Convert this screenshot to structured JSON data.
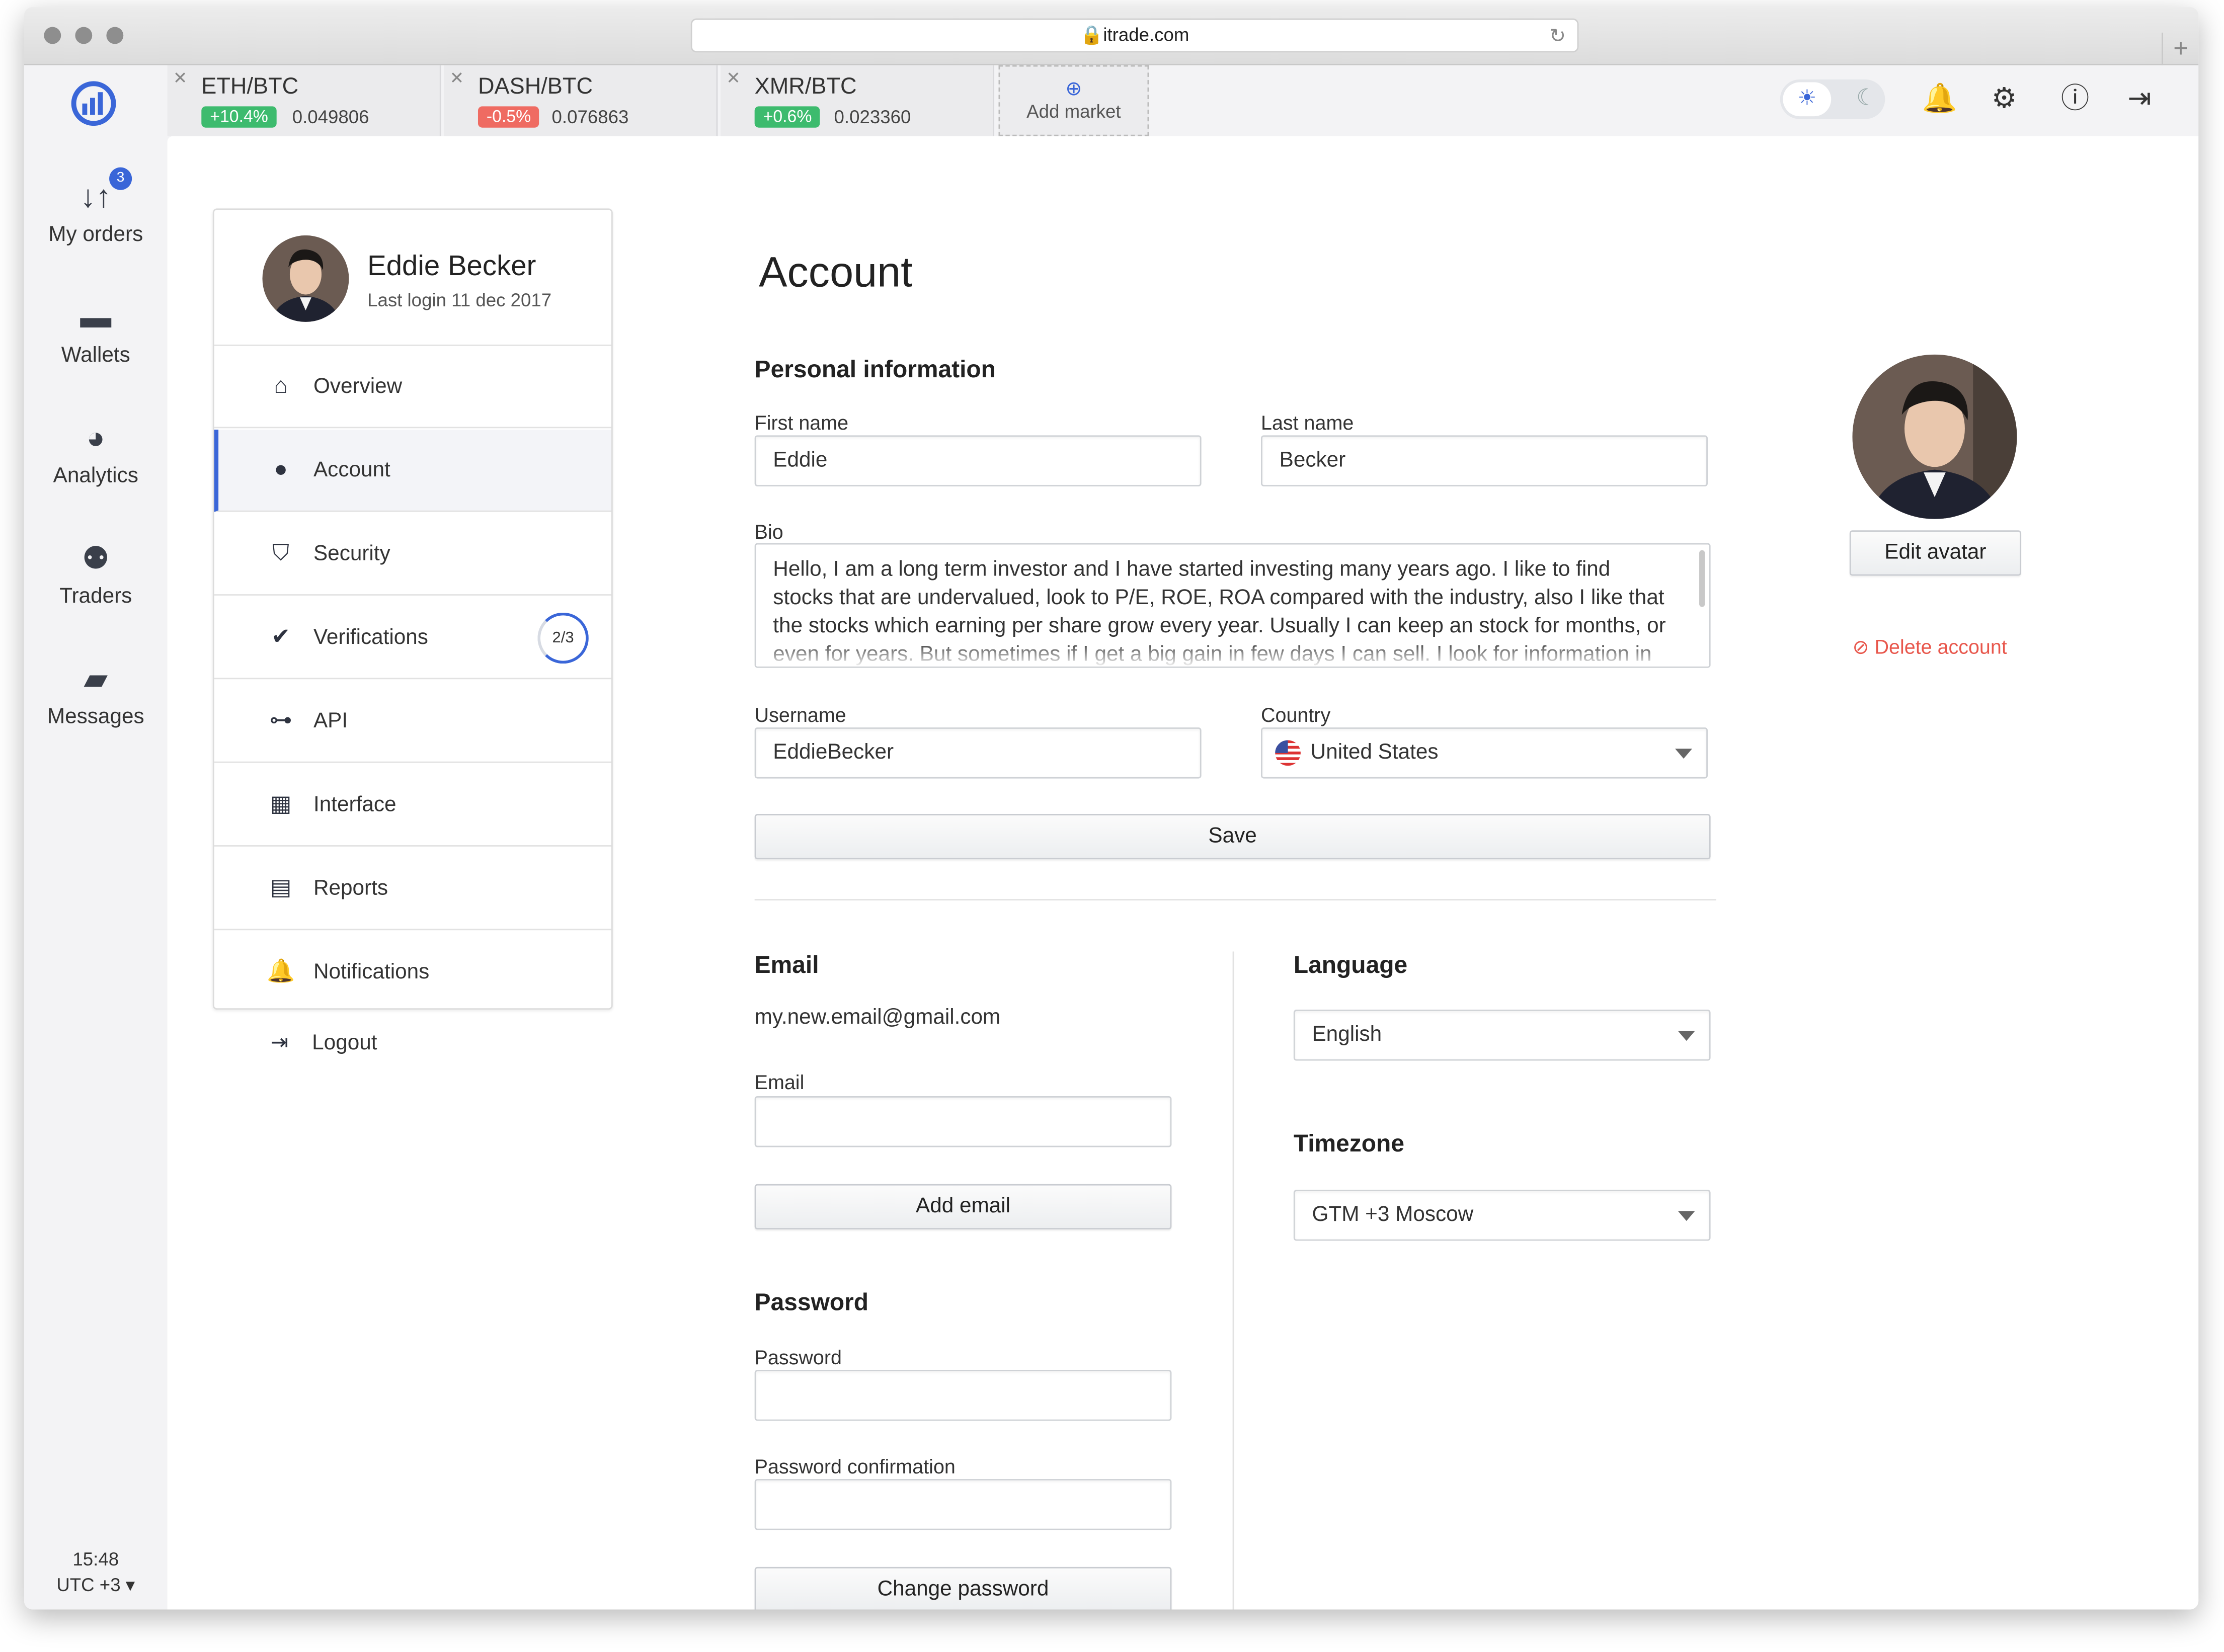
{
  "browser": {
    "url": "itrade.com"
  },
  "sidebar": {
    "items": [
      {
        "label": "My orders",
        "icon": "orders-arrows-icon",
        "badge": "3"
      },
      {
        "label": "Wallets",
        "icon": "wallet-icon"
      },
      {
        "label": "Analytics",
        "icon": "pie-chart-icon"
      },
      {
        "label": "Traders",
        "icon": "users-icon"
      },
      {
        "label": "Messages",
        "icon": "chat-icon"
      }
    ],
    "time": "15:48",
    "timezone": "UTC +3 ▾"
  },
  "markets": [
    {
      "pair": "ETH/BTC",
      "change": "+10.4%",
      "price": "0.049806",
      "color": "#3dbb6e"
    },
    {
      "pair": "DASH/BTC",
      "change": "-0.5%",
      "price": "0.076863",
      "color": "#ef6b62"
    },
    {
      "pair": "XMR/BTC",
      "change": "+0.6%",
      "price": "0.023360",
      "color": "#3dbb6e"
    }
  ],
  "add_market": "Add market",
  "profile": {
    "name": "Eddie Becker",
    "last_login": "Last login 11 dec 2017"
  },
  "menu": [
    {
      "label": "Overview",
      "icon": "home-icon"
    },
    {
      "label": "Account",
      "icon": "user-icon"
    },
    {
      "label": "Security",
      "icon": "shield-icon"
    },
    {
      "label": "Verifications",
      "icon": "check-badge-icon",
      "progress": "2/3"
    },
    {
      "label": "API",
      "icon": "plug-icon"
    },
    {
      "label": "Interface",
      "icon": "table-icon"
    },
    {
      "label": "Reports",
      "icon": "document-icon"
    },
    {
      "label": "Notifications",
      "icon": "bell-icon"
    }
  ],
  "logout": "Logout",
  "account": {
    "title": "Account",
    "personal_title": "Personal information",
    "first_name_label": "First name",
    "first_name": "Eddie",
    "last_name_label": "Last name",
    "last_name": "Becker",
    "bio_label": "Bio",
    "bio": "Hello, I am a long term investor and I have started investing many years ago. I like to find stocks that are undervalued,  look to P/E, ROE, ROA compared with the industry, also I like that the stocks which earning per share grow every year. Usually I can keep an stock for months, or even for years. But sometimes if I get a big gain in few days I can sell.  I look for information in",
    "username_label": "Username",
    "username": "EddieBecker",
    "country_label": "Country",
    "country": "United States",
    "save": "Save",
    "email_title": "Email",
    "current_email": "my.new.email@gmail.com",
    "email_label": "Email",
    "email_value": "",
    "add_email": "Add email",
    "password_title": "Password",
    "password_label": "Password",
    "password_confirm_label": "Password confirmation",
    "change_password": "Change password",
    "language_title": "Language",
    "language": "English",
    "timezone_title": "Timezone",
    "timezone": "GTM +3 Moscow",
    "edit_avatar": "Edit avatar",
    "delete_account": "Delete account"
  },
  "colors": {
    "accent": "#3a66d8",
    "danger": "#e8574c"
  }
}
